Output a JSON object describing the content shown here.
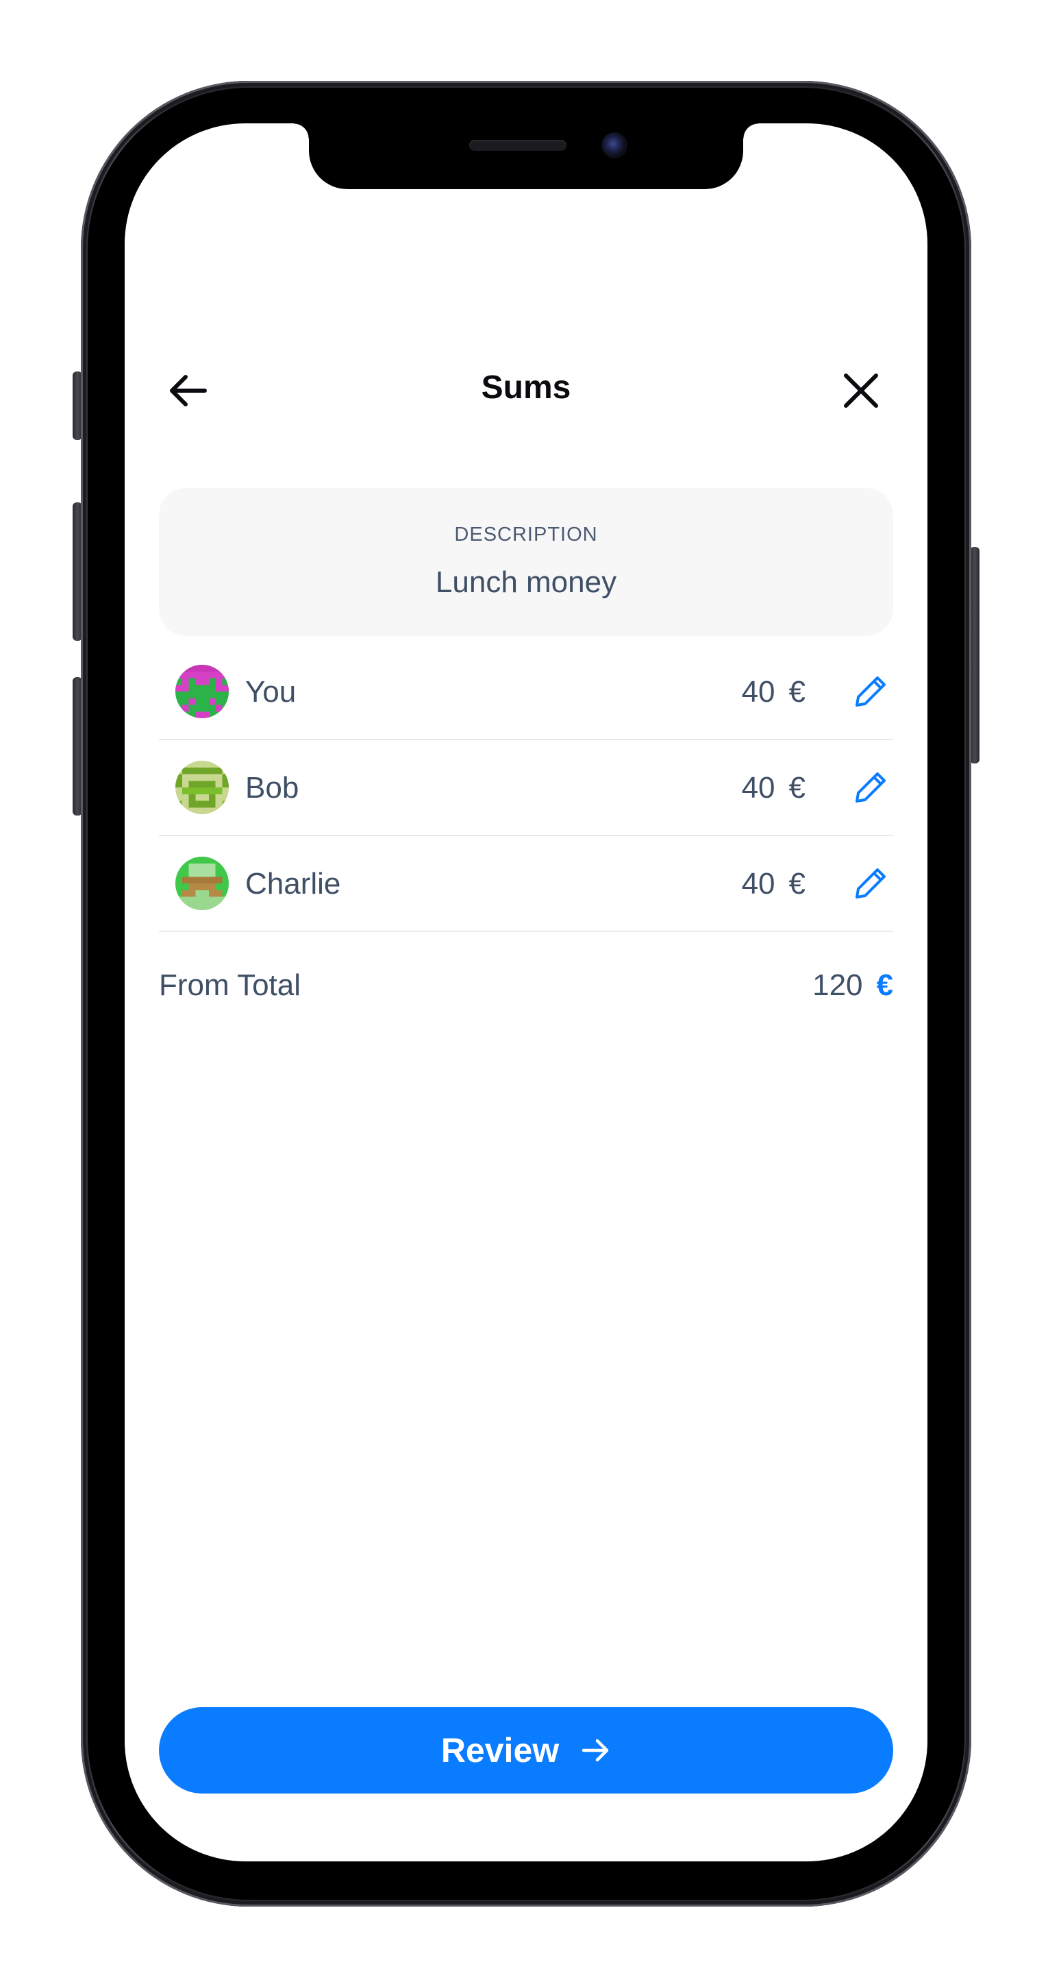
{
  "header": {
    "title": "Sums",
    "back_icon": "arrow-left-icon",
    "close_icon": "close-icon"
  },
  "description": {
    "label": "DESCRIPTION",
    "value": "Lunch money"
  },
  "participants": [
    {
      "name": "You",
      "amount": "40",
      "currency": "€",
      "avatar": "pixel-avatar-magenta-green"
    },
    {
      "name": "Bob",
      "amount": "40",
      "currency": "€",
      "avatar": "pixel-avatar-olive-lime"
    },
    {
      "name": "Charlie",
      "amount": "40",
      "currency": "€",
      "avatar": "pixel-avatar-green-brown"
    }
  ],
  "total": {
    "label": "From Total",
    "amount": "120",
    "currency": "€"
  },
  "footer": {
    "review_label": "Review",
    "review_icon": "arrow-right-icon"
  },
  "colors": {
    "accent": "#0a7cff",
    "text": "#3f4f66",
    "title": "#0b0b0f",
    "card_bg": "#f7f7f8",
    "divider": "#e9eaee"
  }
}
